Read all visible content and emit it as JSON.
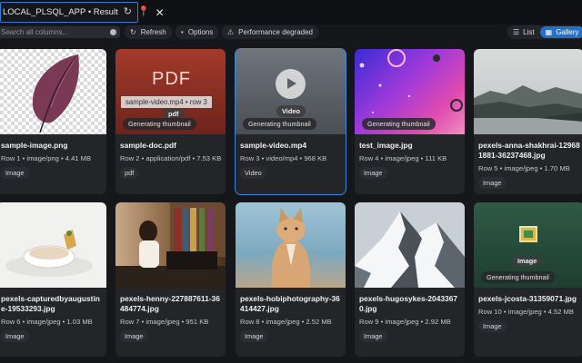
{
  "tab": {
    "title": "LOCAL_PLSQL_APP • Result"
  },
  "toolbar": {
    "search_placeholder": "Search all columns...",
    "refresh_label": "Refresh",
    "options_label": "Options",
    "performance_label": "Performance degraded",
    "view_list_label": "List",
    "view_gallery_label": "Gallery"
  },
  "gallery": {
    "generating_label": "Generating thumbnail",
    "cards": [
      {
        "name": "sample-image.png",
        "sub": "Row 1 • image/png • 4.41 MB",
        "kind": "Image"
      },
      {
        "name": "sample-doc.pdf",
        "sub": "Row 2 • application/pdf • 7.53 KB",
        "kind": "pdf",
        "thumb_text": "PDF",
        "chip": "pdf",
        "tooltip": "sample-video.mp4 • row 3"
      },
      {
        "name": "sample-video.mp4",
        "sub": "Row 3 • video/mp4 • 968 KB",
        "kind": "Video",
        "chip": "Video"
      },
      {
        "name": "test_image.jpg",
        "sub": "Row 4 • image/jpeg • 111 KB",
        "kind": "Image"
      },
      {
        "name": "pexels-anna-shakhrai-129681881-36237468.jpg",
        "sub": "Row 5 • image/jpeg • 1.70 MB",
        "kind": "Image"
      },
      {
        "name": "pexels-capturedbyaugustine-19533293.jpg",
        "sub": "Row 6 • image/jpeg • 1.03 MB",
        "kind": "Image"
      },
      {
        "name": "pexels-henny-227887611-36484774.jpg",
        "sub": "Row 7 • image/jpeg • 951 KB",
        "kind": "Image"
      },
      {
        "name": "pexels-hobiphotography-36414427.jpg",
        "sub": "Row 8 • image/jpeg • 2.52 MB",
        "kind": "Image"
      },
      {
        "name": "pexels-hugosykes-20433670.jpg",
        "sub": "Row 9 • image/jpeg • 2.92 MB",
        "kind": "Image"
      },
      {
        "name": "pexels-jcosta-31359071.jpg",
        "sub": "Row 10 • image/jpeg • 4.52 MB",
        "kind": "Image",
        "chip": "Image"
      }
    ]
  },
  "colors": {
    "accent": "#2470c7",
    "selected_border": "#3a86d9",
    "background": "#16171a",
    "card": "#232529"
  },
  "icons": [
    "refresh-icon",
    "pin-icon",
    "close-icon",
    "search-icon",
    "warning-icon",
    "list-icon",
    "gallery-icon",
    "play-icon",
    "image-icon"
  ]
}
